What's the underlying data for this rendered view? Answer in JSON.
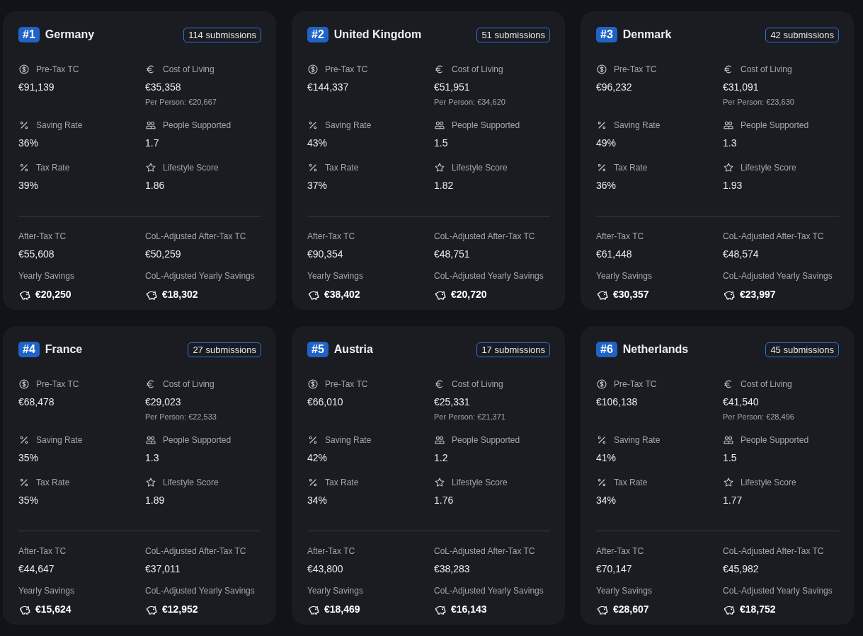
{
  "cards": [
    {
      "rank": "#1",
      "country": "Germany",
      "submissions": "114 submissions",
      "stats": [
        {
          "kind": "dollar",
          "label": "Pre-Tax TC",
          "value": "€91,139"
        },
        {
          "kind": "euro",
          "label": "Cost of Living",
          "value": "€35,358",
          "note": "Per Person: €20,667"
        },
        {
          "kind": "percent",
          "label": "Saving Rate",
          "value": "36%"
        },
        {
          "kind": "people",
          "label": "People Supported",
          "value": "1.7"
        },
        {
          "kind": "percent",
          "label": "Tax Rate",
          "value": "39%"
        },
        {
          "kind": "star",
          "label": "Lifestyle Score",
          "value": "1.86"
        }
      ],
      "totals": [
        {
          "kind": "plain",
          "label": "After-Tax TC",
          "value": "€55,608"
        },
        {
          "kind": "plain",
          "label": "CoL-Adjusted After-Tax TC",
          "value": "€50,259"
        },
        {
          "kind": "savings",
          "label": "Yearly Savings",
          "value": "€20,250"
        },
        {
          "kind": "savings",
          "label": "CoL-Adjusted Yearly Savings",
          "value": "€18,302"
        }
      ]
    },
    {
      "rank": "#2",
      "country": "United Kingdom",
      "submissions": "51 submissions",
      "stats": [
        {
          "kind": "dollar",
          "label": "Pre-Tax TC",
          "value": "€144,337"
        },
        {
          "kind": "euro",
          "label": "Cost of Living",
          "value": "€51,951",
          "note": "Per Person: €34,620"
        },
        {
          "kind": "percent",
          "label": "Saving Rate",
          "value": "43%"
        },
        {
          "kind": "people",
          "label": "People Supported",
          "value": "1.5"
        },
        {
          "kind": "percent",
          "label": "Tax Rate",
          "value": "37%"
        },
        {
          "kind": "star",
          "label": "Lifestyle Score",
          "value": "1.82"
        }
      ],
      "totals": [
        {
          "kind": "plain",
          "label": "After-Tax TC",
          "value": "€90,354"
        },
        {
          "kind": "plain",
          "label": "CoL-Adjusted After-Tax TC",
          "value": "€48,751"
        },
        {
          "kind": "savings",
          "label": "Yearly Savings",
          "value": "€38,402"
        },
        {
          "kind": "savings",
          "label": "CoL-Adjusted Yearly Savings",
          "value": "€20,720"
        }
      ]
    },
    {
      "rank": "#3",
      "country": "Denmark",
      "submissions": "42 submissions",
      "stats": [
        {
          "kind": "dollar",
          "label": "Pre-Tax TC",
          "value": "€96,232"
        },
        {
          "kind": "euro",
          "label": "Cost of Living",
          "value": "€31,091",
          "note": "Per Person: €23,630"
        },
        {
          "kind": "percent",
          "label": "Saving Rate",
          "value": "49%"
        },
        {
          "kind": "people",
          "label": "People Supported",
          "value": "1.3"
        },
        {
          "kind": "percent",
          "label": "Tax Rate",
          "value": "36%"
        },
        {
          "kind": "star",
          "label": "Lifestyle Score",
          "value": "1.93"
        }
      ],
      "totals": [
        {
          "kind": "plain",
          "label": "After-Tax TC",
          "value": "€61,448"
        },
        {
          "kind": "plain",
          "label": "CoL-Adjusted After-Tax TC",
          "value": "€48,574"
        },
        {
          "kind": "savings",
          "label": "Yearly Savings",
          "value": "€30,357"
        },
        {
          "kind": "savings",
          "label": "CoL-Adjusted Yearly Savings",
          "value": "€23,997"
        }
      ]
    },
    {
      "rank": "#4",
      "country": "France",
      "submissions": "27 submissions",
      "stats": [
        {
          "kind": "dollar",
          "label": "Pre-Tax TC",
          "value": "€68,478"
        },
        {
          "kind": "euro",
          "label": "Cost of Living",
          "value": "€29,023",
          "note": "Per Person: €22,533"
        },
        {
          "kind": "percent",
          "label": "Saving Rate",
          "value": "35%"
        },
        {
          "kind": "people",
          "label": "People Supported",
          "value": "1.3"
        },
        {
          "kind": "percent",
          "label": "Tax Rate",
          "value": "35%"
        },
        {
          "kind": "star",
          "label": "Lifestyle Score",
          "value": "1.89"
        }
      ],
      "totals": [
        {
          "kind": "plain",
          "label": "After-Tax TC",
          "value": "€44,647"
        },
        {
          "kind": "plain",
          "label": "CoL-Adjusted After-Tax TC",
          "value": "€37,011"
        },
        {
          "kind": "savings",
          "label": "Yearly Savings",
          "value": "€15,624"
        },
        {
          "kind": "savings",
          "label": "CoL-Adjusted Yearly Savings",
          "value": "€12,952"
        }
      ]
    },
    {
      "rank": "#5",
      "country": "Austria",
      "submissions": "17 submissions",
      "stats": [
        {
          "kind": "dollar",
          "label": "Pre-Tax TC",
          "value": "€66,010"
        },
        {
          "kind": "euro",
          "label": "Cost of Living",
          "value": "€25,331",
          "note": "Per Person: €21,371"
        },
        {
          "kind": "percent",
          "label": "Saving Rate",
          "value": "42%"
        },
        {
          "kind": "people",
          "label": "People Supported",
          "value": "1.2"
        },
        {
          "kind": "percent",
          "label": "Tax Rate",
          "value": "34%"
        },
        {
          "kind": "star",
          "label": "Lifestyle Score",
          "value": "1.76"
        }
      ],
      "totals": [
        {
          "kind": "plain",
          "label": "After-Tax TC",
          "value": "€43,800"
        },
        {
          "kind": "plain",
          "label": "CoL-Adjusted After-Tax TC",
          "value": "€38,283"
        },
        {
          "kind": "savings",
          "label": "Yearly Savings",
          "value": "€18,469"
        },
        {
          "kind": "savings",
          "label": "CoL-Adjusted Yearly Savings",
          "value": "€16,143"
        }
      ]
    },
    {
      "rank": "#6",
      "country": "Netherlands",
      "submissions": "45 submissions",
      "stats": [
        {
          "kind": "dollar",
          "label": "Pre-Tax TC",
          "value": "€106,138"
        },
        {
          "kind": "euro",
          "label": "Cost of Living",
          "value": "€41,540",
          "note": "Per Person: €28,496"
        },
        {
          "kind": "percent",
          "label": "Saving Rate",
          "value": "41%"
        },
        {
          "kind": "people",
          "label": "People Supported",
          "value": "1.5"
        },
        {
          "kind": "percent",
          "label": "Tax Rate",
          "value": "34%"
        },
        {
          "kind": "star",
          "label": "Lifestyle Score",
          "value": "1.77"
        }
      ],
      "totals": [
        {
          "kind": "plain",
          "label": "After-Tax TC",
          "value": "€70,147"
        },
        {
          "kind": "plain",
          "label": "CoL-Adjusted After-Tax TC",
          "value": "€45,982"
        },
        {
          "kind": "savings",
          "label": "Yearly Savings",
          "value": "€28,607"
        },
        {
          "kind": "savings",
          "label": "CoL-Adjusted Yearly Savings",
          "value": "€18,752"
        }
      ]
    }
  ]
}
